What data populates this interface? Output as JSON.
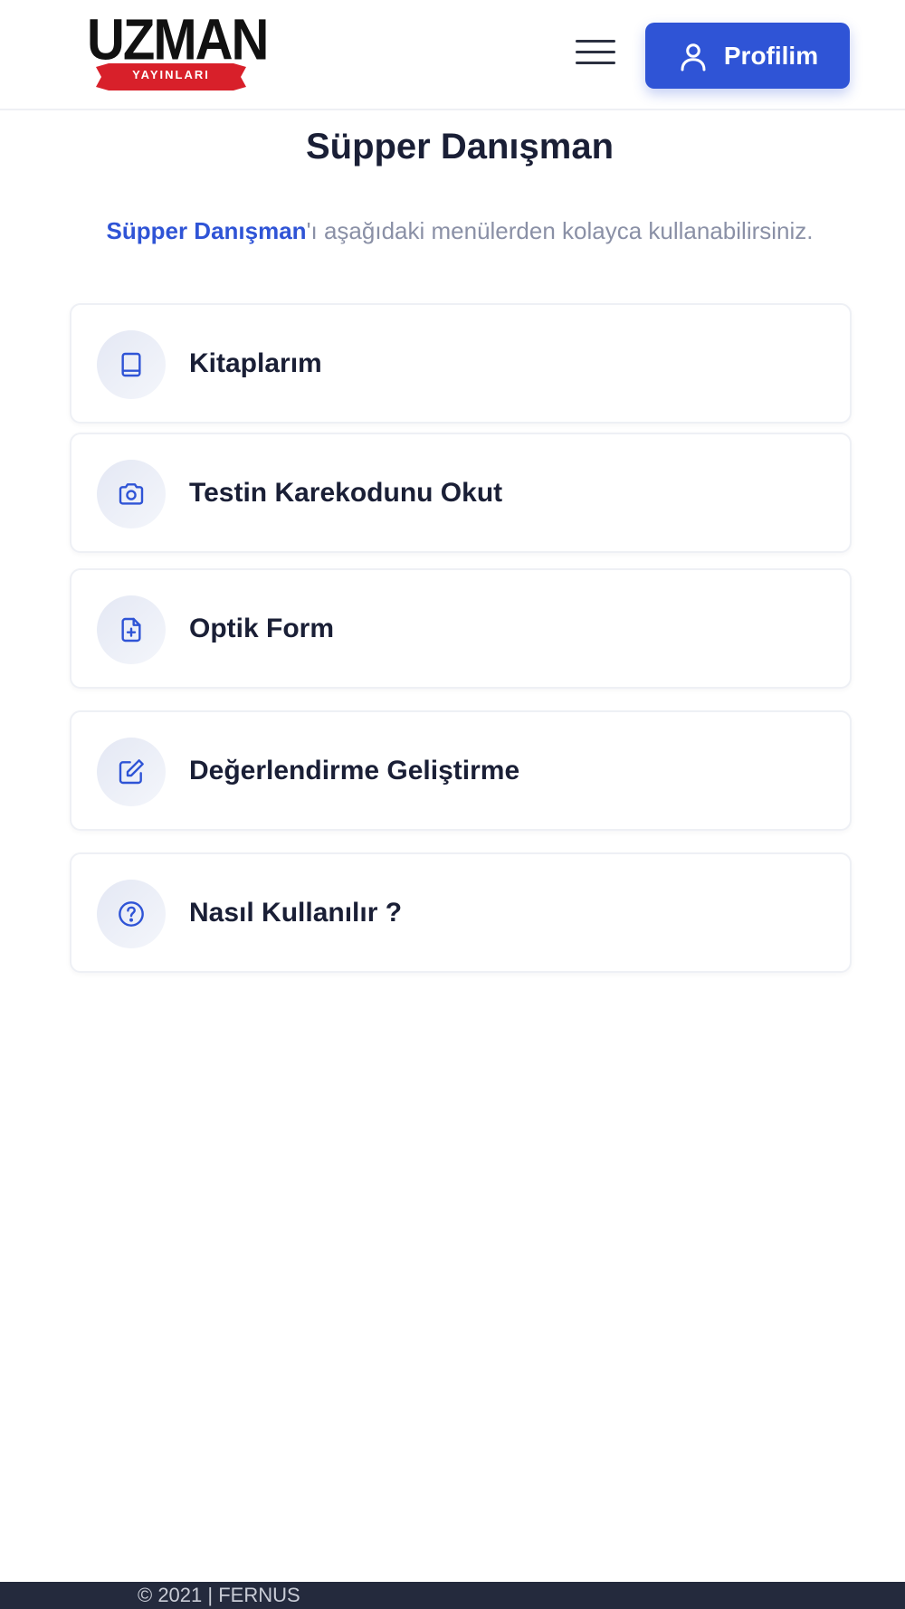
{
  "header": {
    "logo_text": "UZMAN",
    "logo_subtext": "YAYINLARI",
    "profile_label": "Profilim"
  },
  "main": {
    "title": "Süpper Danışman",
    "intro_highlight": "Süpper Danışman",
    "intro_rest": "'ı aşağıdaki menülerden kolayca kullanabilirsiniz.",
    "menu_items": [
      {
        "label": "Kitaplarım",
        "icon": "book-icon"
      },
      {
        "label": "Testin Karekodunu Okut",
        "icon": "camera-icon"
      },
      {
        "label": "Optik Form",
        "icon": "file-plus-icon"
      },
      {
        "label": "Değerlendirme Geliştirme",
        "icon": "edit-icon"
      },
      {
        "label": "Nasıl Kullanılır ?",
        "icon": "help-circle-icon"
      }
    ]
  },
  "footer": {
    "copyright": "© 2021 | FERNUS"
  },
  "colors": {
    "accent": "#2f54d6",
    "text": "#1a1f36",
    "muted": "#8a90a6",
    "footer_bg": "#242a3d",
    "logo_red": "#d8202a"
  }
}
